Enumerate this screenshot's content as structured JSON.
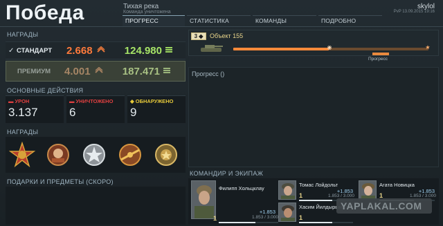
{
  "header": {
    "title": "Победа",
    "map_name": "Тихая река",
    "battle_mode": "Команда уничтожена",
    "username": "skylol",
    "server_datetime": "PvP 13.09.2015 19:16"
  },
  "tabs": [
    {
      "label": "ПРОГРЕСС",
      "active": true
    },
    {
      "label": "СТАТИСТИКА",
      "active": false
    },
    {
      "label": "КОМАНДЫ",
      "active": false
    },
    {
      "label": "ПОДРОБНО",
      "active": false
    }
  ],
  "rewards": {
    "section_label": "НАГРАДЫ",
    "standard": {
      "label": "СТАНДАРТ",
      "credits": "2.668",
      "xp": "124.980"
    },
    "premium": {
      "label": "ПРЕМИУМ",
      "credits": "4.001",
      "xp": "187.471"
    },
    "colors": {
      "credits": "#ff7a3b",
      "xp": "#a6e467"
    }
  },
  "actions": {
    "section_label": "ОСНОВНЫЕ ДЕЙСТВИЯ",
    "damage": {
      "label": "УРОН",
      "value": "3.137"
    },
    "destroyed": {
      "label": "УНИЧТОЖЕНО",
      "value": "6"
    },
    "spotted": {
      "label": "ОБНАРУЖЕНО",
      "value": "9"
    }
  },
  "medals": {
    "section_label": "НАГРАДЫ",
    "items": [
      "order-medal-icon",
      "bronze-emblem-icon",
      "silver-star-icon",
      "gold-sword-icon",
      "gold-badge-icon"
    ]
  },
  "gifts": {
    "section_label": "ПОДАРКИ И ПРЕДМЕТЫ (СКОРО)"
  },
  "tank": {
    "tier": "3",
    "name": "Объект 155",
    "progress_label": "Прогресс",
    "progress_fraction": 0.49
  },
  "progress_panel": {
    "title": "Прогресс ()"
  },
  "crew": {
    "section_label": "КОМАНДИР И ЭКИПАЖ",
    "members": [
      {
        "name": "Филипп Хольцклау",
        "level": "1",
        "gain": "+1.853",
        "exp": "1.853 / 3.000",
        "progress": 0.62
      },
      {
        "name": "Томас Лойдольт",
        "level": "1",
        "gain": "+1.853",
        "exp": "1.853 / 3.000",
        "progress": 0.62
      },
      {
        "name": "Агата Новицка",
        "level": "1",
        "gain": "+1.853",
        "exp": "1.853 / 3.000",
        "progress": 0.62
      },
      {
        "name": "Хасим Йилдырым",
        "level": "1",
        "gain": "+1.853",
        "exp": "1.853 / 3.000",
        "progress": 0.62
      }
    ]
  },
  "watermark": "YAPLAKAL.COM"
}
